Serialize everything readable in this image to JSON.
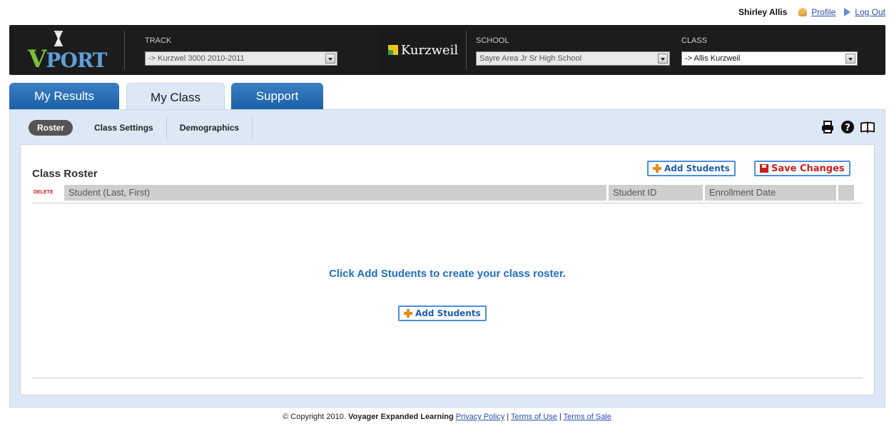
{
  "user": {
    "name": "Shirley Allis",
    "profile_label": "Profile",
    "logout_label": "Log Out"
  },
  "header": {
    "logo_text_v": "V",
    "logo_text_rest": "PORT",
    "track_label": "TRACK",
    "track_value": "-> Kurzwel 3000 2010-2011",
    "partner_name": "Kurzweil",
    "school_label": "SCHOOL",
    "school_value": "Sayre Area Jr Sr High School",
    "class_label": "CLASS",
    "class_value": "-> Allis Kurzweil"
  },
  "tabs": [
    {
      "label": "My Results"
    },
    {
      "label": "My Class"
    },
    {
      "label": "Support"
    }
  ],
  "subnav": {
    "items": [
      {
        "label": "Roster"
      },
      {
        "label": "Class Settings"
      },
      {
        "label": "Demographics"
      }
    ]
  },
  "tools": [
    "printer-icon",
    "help-icon",
    "book-icon"
  ],
  "roster": {
    "title": "Class Roster",
    "add_students_label": "Add Students",
    "save_changes_label": "Save Changes",
    "delete_label": "DELETE",
    "columns": [
      "Student (Last, First)",
      "Student ID",
      "Enrollment Date"
    ],
    "empty_message": "Click Add Students to create your class roster.",
    "empty_add_label": "Add Students"
  },
  "footer": {
    "copyright": "© Copyright 2010.",
    "company": "Voyager Expanded Learning",
    "privacy": "Privacy Policy",
    "terms_use": "Terms of Use",
    "terms_sale": "Terms of Sale",
    "sep": "|"
  },
  "colors": {
    "header_bg": "#1c1c1c",
    "tab_blue": "#1a5ea6",
    "panel_bg": "#dce8f6",
    "link_blue": "#2a4fb0",
    "accent_red": "#cc1f1f",
    "accent_orange": "#e88a1a"
  }
}
